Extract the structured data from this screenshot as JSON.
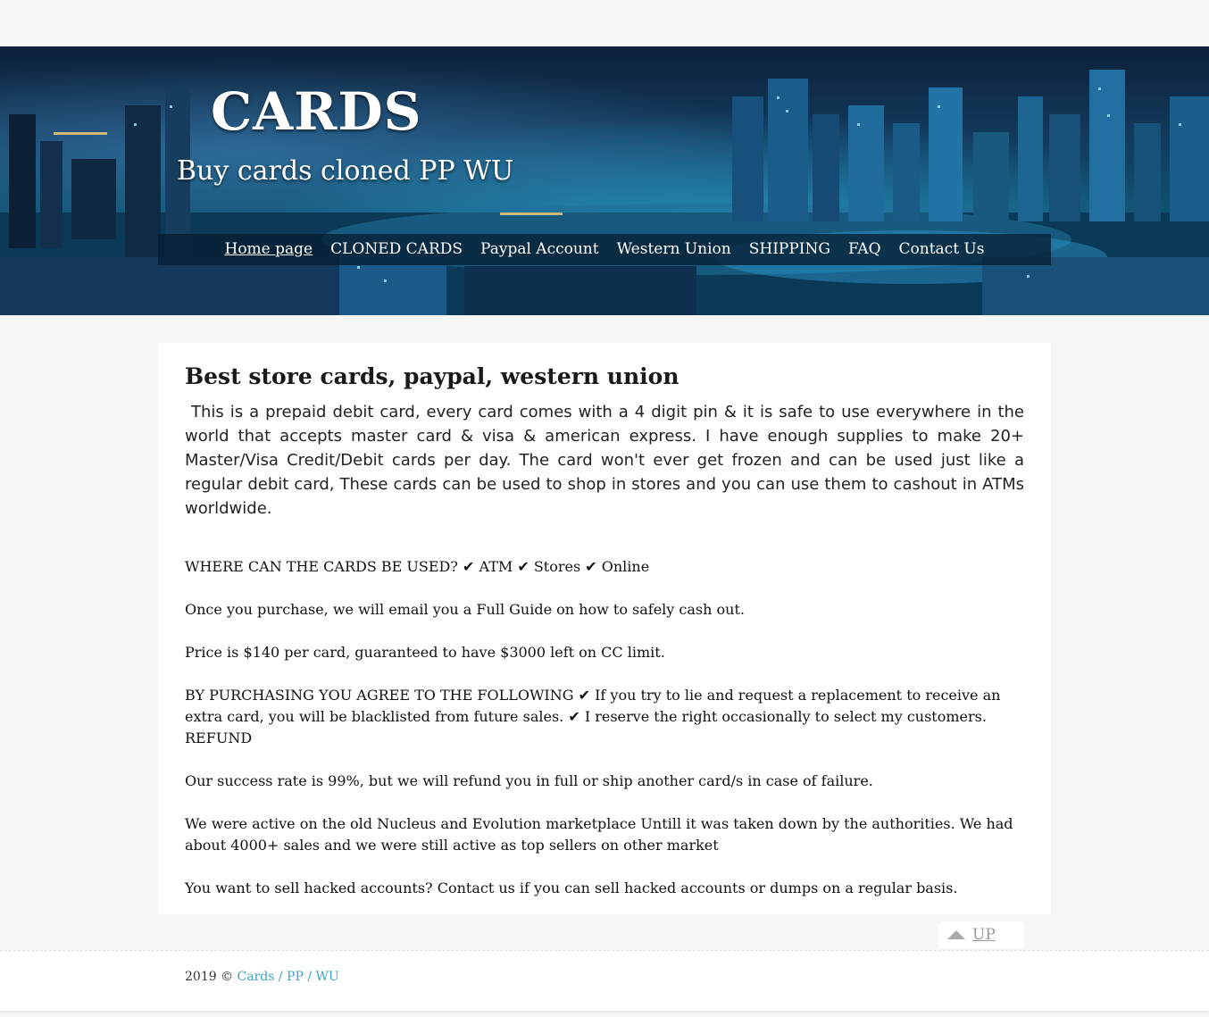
{
  "header": {
    "title": "CARDS",
    "subtitle": "Buy cards cloned PP WU"
  },
  "nav": {
    "items": [
      {
        "label": "Home page",
        "active": true
      },
      {
        "label": "CLONED CARDS"
      },
      {
        "label": "Paypal Account"
      },
      {
        "label": "Western Union"
      },
      {
        "label": "SHIPPING"
      },
      {
        "label": "FAQ"
      },
      {
        "label": "Contact Us"
      }
    ]
  },
  "main": {
    "heading": "Best store cards, paypal, western union",
    "lead": " This is a prepaid debit card, every card comes with a 4 digit pin & it is safe to use everywhere in the world that accepts master card & visa & american express. I have enough supplies to make 20+ Master/Visa Credit/Debit cards per day. The card won't ever get frozen and can be used just like a regular debit card, These cards can be used to shop in stores and you can use them to cashout in ATMs worldwide.",
    "paragraphs": [
      "WHERE CAN THE CARDS BE USED? ✔ ATM ✔ Stores ✔ Online",
      "Once you purchase, we will email you a Full Guide on how to safely cash out.",
      "Price is $140 per card, guaranteed to have $3000 left on CC limit.",
      "BY PURCHASING YOU AGREE TO THE FOLLOWING ✔ If you try to lie and request a replacement to receive an extra card, you will be blacklisted from future sales. ✔ I reserve the right occasionally to select my customers. REFUND",
      "Our success rate is 99%, but we will refund you in full or ship another card/s in case of failure.",
      "We were active on the old Nucleus and Evolution marketplace Untill it was taken down by the authorities. We had about 4000+ sales and we were still active as top sellers on other market",
      "You want to sell hacked accounts? Contact us if you can sell hacked accounts or dumps on a regular basis."
    ]
  },
  "up_button": {
    "label": "UP",
    "icon": "triangle-up-icon"
  },
  "footer": {
    "copyright": "2019 © ",
    "link_label": "Cards / PP / WU"
  },
  "colors": {
    "link": "#3aa3c0",
    "nav_bg": "#0a2a44",
    "page_bg": "#f7f7f7"
  }
}
